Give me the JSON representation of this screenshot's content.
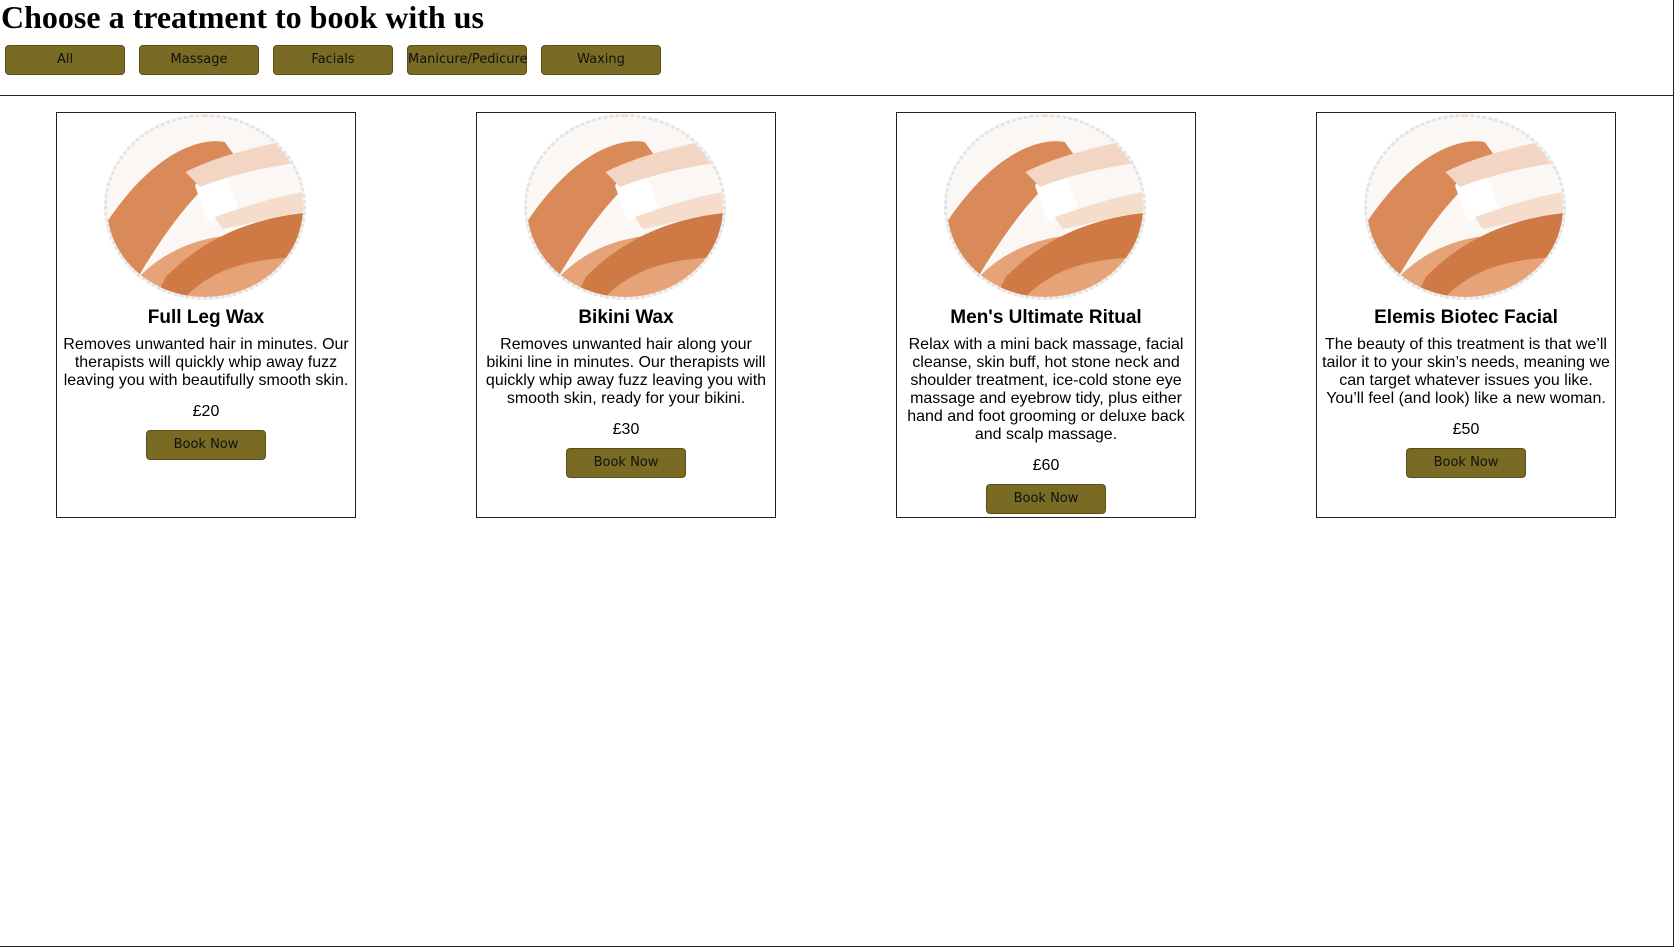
{
  "page": {
    "title": "Choose a treatment to book with us"
  },
  "filters": [
    {
      "label": "All"
    },
    {
      "label": "Massage"
    },
    {
      "label": "Facials"
    },
    {
      "label": "Manicure/Pedicure"
    },
    {
      "label": "Waxing"
    }
  ],
  "colors": {
    "button_bg": "#7a6b24",
    "button_border": "#5a4f18"
  },
  "treatments": [
    {
      "name": "Full Leg Wax",
      "description": "Removes unwanted hair in minutes. Our therapists will quickly whip away fuzz leaving you with beautifully smooth skin.",
      "price": "£20",
      "button_label": "Book Now",
      "image_icon": "leg-wax-image"
    },
    {
      "name": "Bikini Wax",
      "description": "Removes unwanted hair along your bikini line in minutes. Our therapists will quickly whip away fuzz leaving you with smooth skin, ready for your bikini.",
      "price": "£30",
      "button_label": "Book Now",
      "image_icon": "leg-wax-image"
    },
    {
      "name": "Men's Ultimate Ritual",
      "description": "Relax with a mini back massage, facial cleanse, skin buff, hot stone neck and shoulder treatment, ice-cold stone eye massage and eyebrow tidy, plus either hand and foot grooming or deluxe back and scalp massage.",
      "price": "£60",
      "button_label": "Book Now",
      "image_icon": "leg-wax-image"
    },
    {
      "name": "Elemis Biotec Facial",
      "description": "The beauty of this treatment is that we’ll tailor it to your skin’s needs, meaning we can target whatever issues you like. You’ll feel (and look) like a new woman.",
      "price": "£50",
      "button_label": "Book Now",
      "image_icon": "leg-wax-image"
    }
  ]
}
